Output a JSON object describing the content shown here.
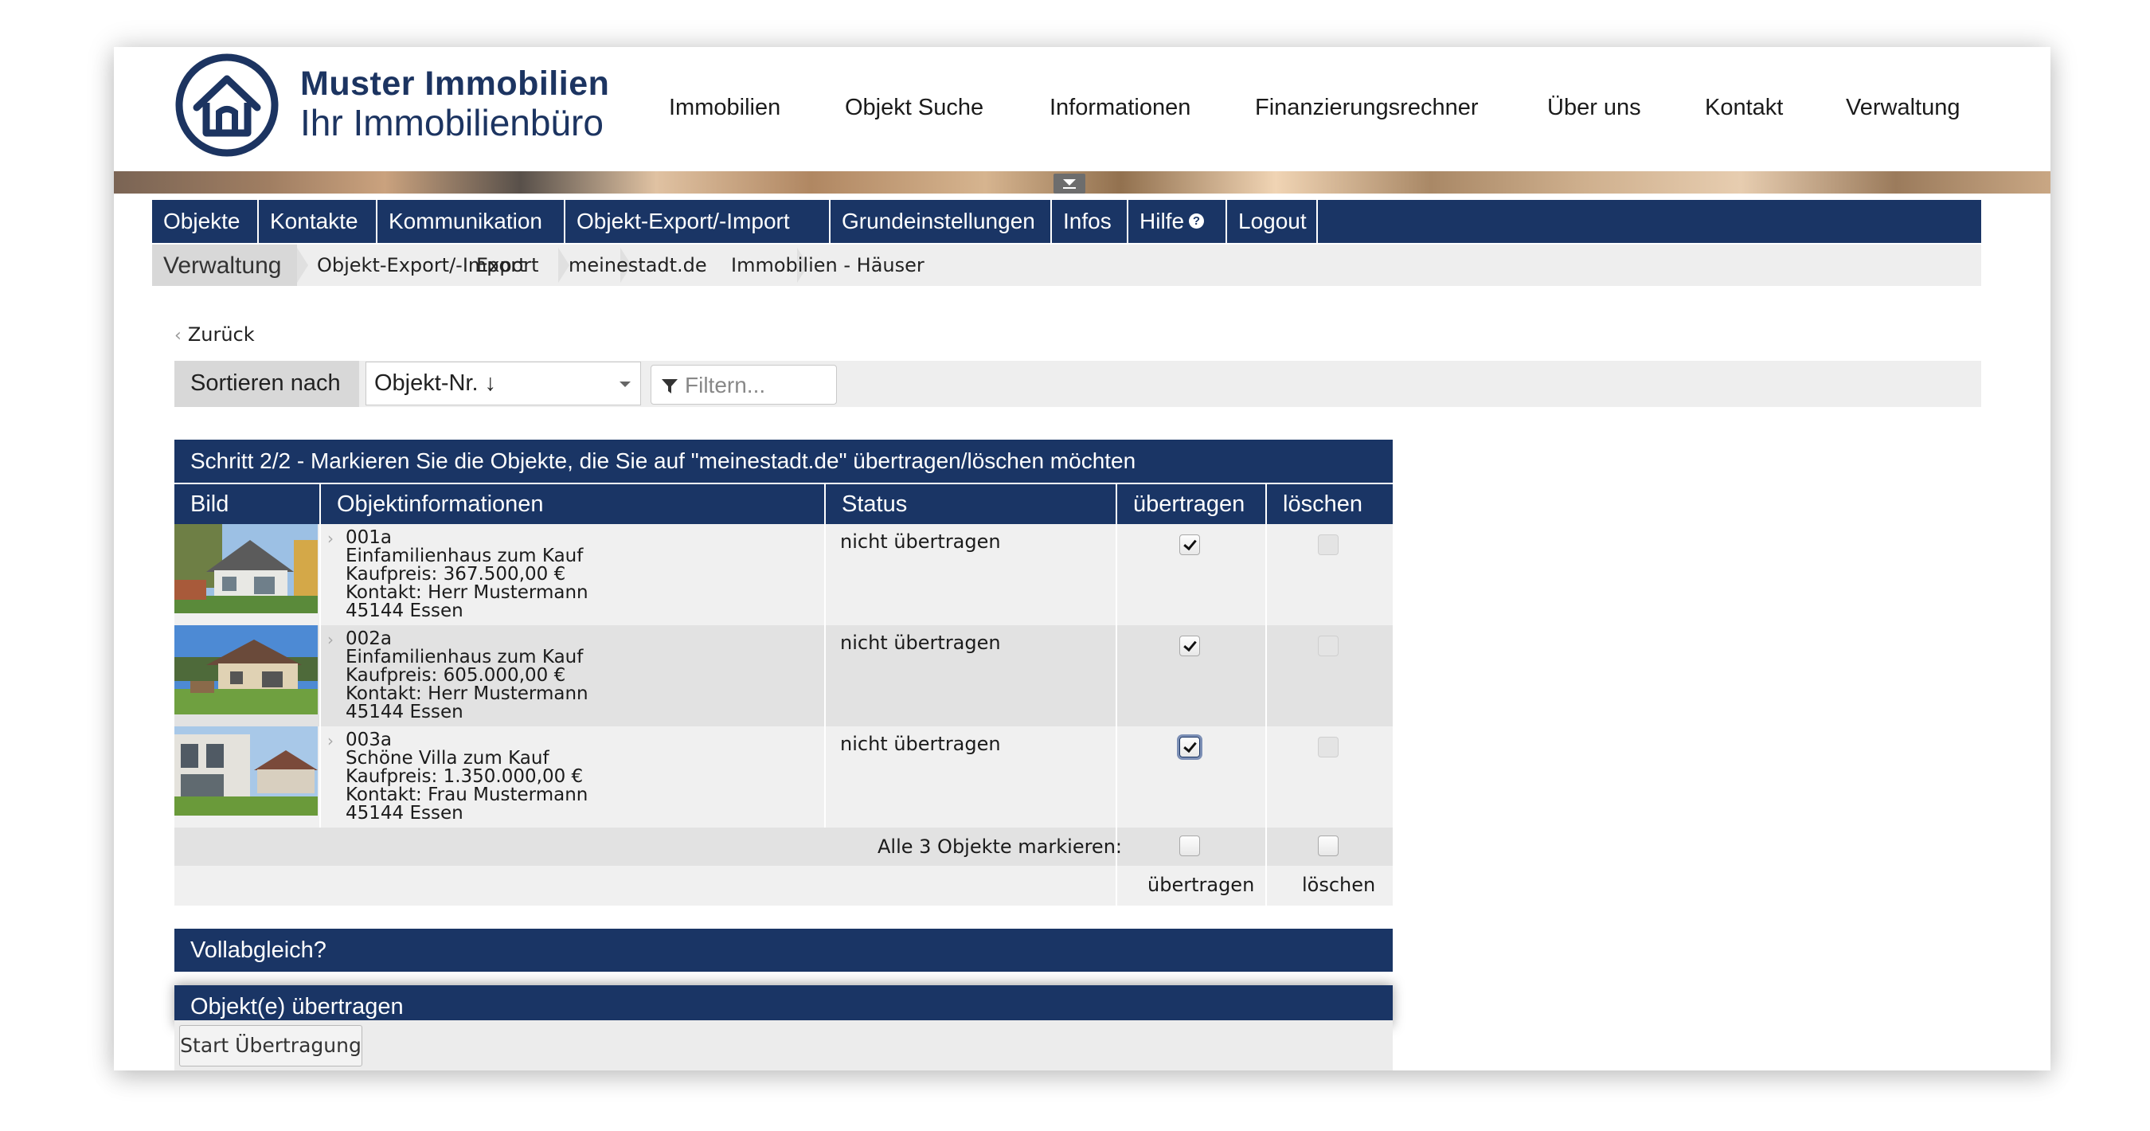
{
  "brand": {
    "title": "Muster Immobilien",
    "subtitle": "Ihr Immobilienbüro"
  },
  "top_nav": [
    "Immobilien",
    "Objekt Suche",
    "Informationen",
    "Finanzierungsrechner",
    "Über uns",
    "Kontakt",
    "Verwaltung"
  ],
  "admin_nav": [
    "Objekte",
    "Kontakte",
    "Kommunikation",
    "Objekt-Export/-Import",
    "Grundeinstellungen",
    "Infos",
    "Hilfe",
    "Logout"
  ],
  "breadcrumb": [
    "Verwaltung",
    "Objekt-Export/-Import",
    "Export",
    "meinestadt.de",
    "Immobilien - Häuser"
  ],
  "back_label": "Zurück",
  "sort": {
    "label": "Sortieren nach",
    "selected": "Objekt-Nr. ↓",
    "filter_placeholder": "Filtern..."
  },
  "table": {
    "title": "Schritt 2/2 - Markieren Sie die Objekte, die Sie auf \"meinestadt.de\" übertragen/löschen möchten",
    "headers": [
      "Bild",
      "Objektinformationen",
      "Status",
      "übertragen",
      "löschen"
    ],
    "rows": [
      {
        "id": "001a",
        "type": "Einfamilienhaus zum Kauf",
        "price": "Kaufpreis: 367.500,00 €",
        "contact": "Kontakt: Herr Mustermann",
        "city": "45144 Essen",
        "status": "nicht übertragen",
        "transfer": true,
        "delete": false
      },
      {
        "id": "002a",
        "type": "Einfamilienhaus zum Kauf",
        "price": "Kaufpreis: 605.000,00 €",
        "contact": "Kontakt: Herr Mustermann",
        "city": "45144 Essen",
        "status": "nicht übertragen",
        "transfer": true,
        "delete": false
      },
      {
        "id": "003a",
        "type": "Schöne Villa zum Kauf",
        "price": "Kaufpreis: 1.350.000,00 €",
        "contact": "Kontakt: Frau Mustermann",
        "city": "45144 Essen",
        "status": "nicht übertragen",
        "transfer": true,
        "delete": false
      }
    ],
    "mark_all_label": "Alle 3 Objekte markieren:",
    "footer_transfer": "übertragen",
    "footer_delete": "löschen"
  },
  "sections": {
    "full_sync": "Vollabgleich?",
    "transfer": "Objekt(e) übertragen"
  },
  "start_button": "Start Übertragung",
  "colors": {
    "navy": "#1a3565",
    "brand_blue": "#1c3461"
  }
}
